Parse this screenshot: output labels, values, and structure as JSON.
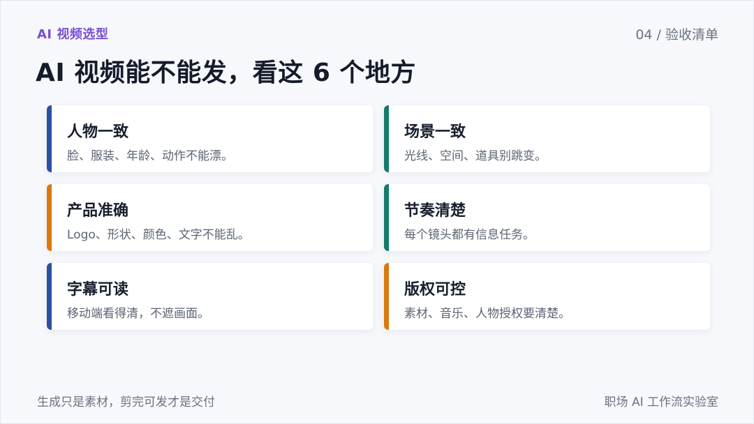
{
  "header": {
    "eyebrow": "AI 视频选型",
    "page_tag": "04 / 验收清单",
    "title": "AI 视频能不能发，看这 6 个地方"
  },
  "cards": [
    {
      "title": "人物一致",
      "desc": "脸、服装、年龄、动作不能漂。",
      "accent": "#2a4fa3"
    },
    {
      "title": "场景一致",
      "desc": "光线、空间、道具别跳变。",
      "accent": "#167a6b"
    },
    {
      "title": "产品准确",
      "desc": "Logo、形状、颜色、文字不能乱。",
      "accent": "#d9790e"
    },
    {
      "title": "节奏清楚",
      "desc": "每个镜头都有信息任务。",
      "accent": "#167a6b"
    },
    {
      "title": "字幕可读",
      "desc": "移动端看得清，不遮画面。",
      "accent": "#2a4fa3"
    },
    {
      "title": "版权可控",
      "desc": "素材、音乐、人物授权要清楚。",
      "accent": "#d9790e"
    }
  ],
  "footer": {
    "left": "生成只是素材，剪完可发才是交付",
    "right": "职场 AI 工作流实验室"
  },
  "colors": {
    "eyebrow": "#7b4fd0",
    "background": "#f6f8fb",
    "card": "#ffffff"
  }
}
